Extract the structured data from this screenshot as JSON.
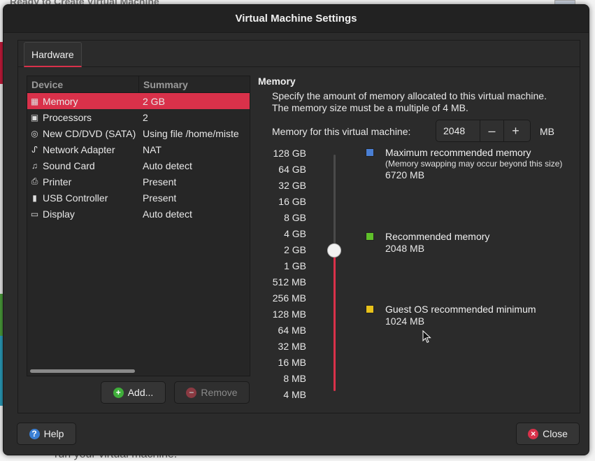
{
  "background": {
    "title": "Ready to Create Virtual Machine",
    "footer": "run your virtual machine."
  },
  "dialog": {
    "title": "Virtual Machine Settings",
    "tab_hardware": "Hardware"
  },
  "devices": {
    "header_device": "Device",
    "header_summary": "Summary",
    "rows": [
      {
        "name": "Memory",
        "summary": "2 GB",
        "icon": "memory-icon"
      },
      {
        "name": "Processors",
        "summary": "2",
        "icon": "processor-icon"
      },
      {
        "name": "New CD/DVD (SATA)",
        "summary": "Using file /home/miste",
        "icon": "cd-icon"
      },
      {
        "name": "Network Adapter",
        "summary": "NAT",
        "icon": "network-icon"
      },
      {
        "name": "Sound Card",
        "summary": "Auto detect",
        "icon": "music-icon"
      },
      {
        "name": "Printer",
        "summary": "Present",
        "icon": "printer-icon"
      },
      {
        "name": "USB Controller",
        "summary": "Present",
        "icon": "usb-icon"
      },
      {
        "name": "Display",
        "summary": "Auto detect",
        "icon": "monitor-icon"
      }
    ],
    "selected_index": 0,
    "add_label": "Add...",
    "remove_label": "Remove"
  },
  "memory": {
    "title": "Memory",
    "description": "Specify the amount of memory allocated to this virtual machine. The memory size must be a multiple of 4 MB.",
    "field_label": "Memory for this virtual machine:",
    "value": "2048",
    "decrement": "–",
    "increment": "+",
    "unit": "MB",
    "scale": [
      "128 GB",
      "64 GB",
      "32 GB",
      "16 GB",
      "8 GB",
      "4 GB",
      "2 GB",
      "1 GB",
      "512 MB",
      "256 MB",
      "128 MB",
      "64 MB",
      "32 MB",
      "16 MB",
      "8 MB",
      "4 MB"
    ],
    "slider_level": "2 GB",
    "legend": {
      "max": {
        "title": "Maximum recommended memory",
        "note": "(Memory swapping may occur beyond this size)",
        "value": "6720 MB",
        "color": "#4a7fd4"
      },
      "recommended": {
        "title": "Recommended memory",
        "value": "2048 MB",
        "color": "#5fbf2a"
      },
      "minimum": {
        "title": "Guest OS recommended minimum",
        "value": "1024 MB",
        "color": "#e8c21a"
      }
    }
  },
  "footer": {
    "help_label": "Help",
    "close_label": "Close"
  },
  "colors": {
    "accent": "#d9314a",
    "dialog_bg": "#2b2b2b"
  }
}
